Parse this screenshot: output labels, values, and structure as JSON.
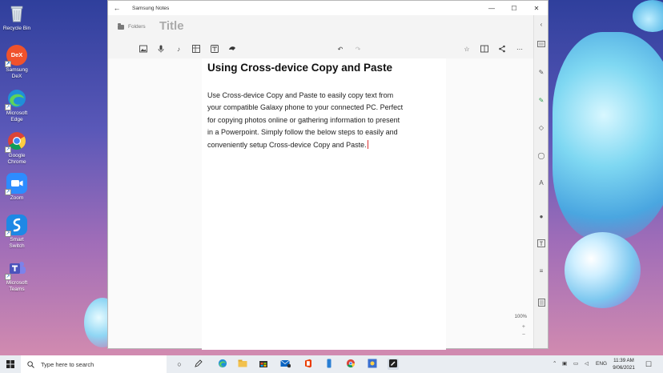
{
  "desktop": {
    "icons": [
      {
        "label": [
          "Recycle Bin"
        ],
        "icon": "recycle-bin-icon",
        "color": "#dfe6ee"
      },
      {
        "label": [
          "Samsung",
          "DeX"
        ],
        "icon": "samsung-dex-icon",
        "badge": "DeX",
        "color": "#f0522c"
      },
      {
        "label": [
          "Microsoft",
          "Edge"
        ],
        "icon": "edge-icon",
        "color": "#1f8fd8"
      },
      {
        "label": [
          "Google",
          "Chrome"
        ],
        "icon": "chrome-icon",
        "color": "#ffffff"
      },
      {
        "label": [
          "Zoom"
        ],
        "icon": "zoom-icon",
        "color": "#2d8cff"
      },
      {
        "label": [
          "Smart Switch"
        ],
        "icon": "smart-switch-icon",
        "color": "#1e88e5"
      },
      {
        "label": [
          "Microsoft",
          "Teams"
        ],
        "icon": "teams-icon",
        "color": "#5b5fc7"
      }
    ]
  },
  "window": {
    "app_title": "Samsung Notes",
    "controls": {
      "minimize": "—",
      "maximize": "☐",
      "close": "✕"
    },
    "header": {
      "folders_label": "Folders",
      "title_placeholder": "Title"
    },
    "note": {
      "heading": "Using Cross-device Copy and Paste",
      "body_lines": [
        "Use Cross-device Copy and Paste to easily copy text from",
        "your compatible Galaxy phone to your connected PC. Perfect",
        "for copying photos online or gathering information to present",
        "in a Powerpoint. Simply follow the below steps to easily and",
        "conveniently setup Cross-device Copy and Paste."
      ]
    },
    "zoom": {
      "level": "100%",
      "plus": "+",
      "minus": "−"
    }
  },
  "taskbar": {
    "search_placeholder": "Type here to search",
    "language": "ENG",
    "time": "11:39 AM",
    "date": "9/06/2021"
  },
  "colors": {
    "accent": "#0078d4",
    "caret": "#dd3333"
  }
}
